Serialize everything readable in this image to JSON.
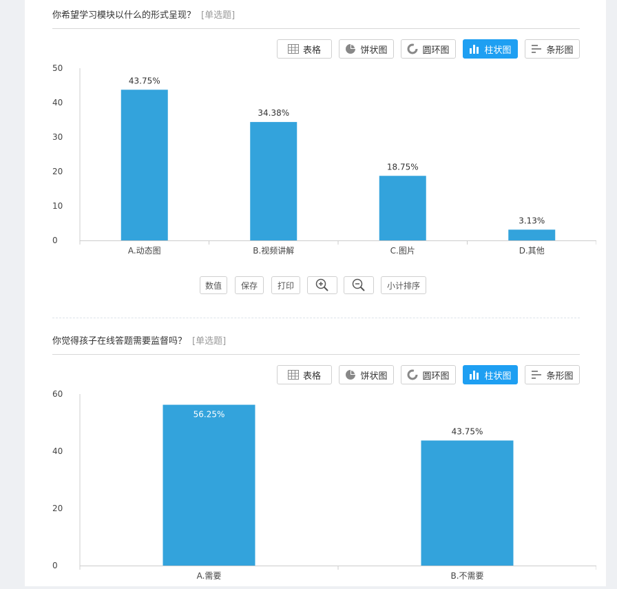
{
  "questions": [
    {
      "title": "你希望学习模块以什么的形式呈现？",
      "tag": "[单选题]",
      "toolbar": [
        "表格",
        "饼状图",
        "圆环图",
        "柱状图",
        "条形图"
      ],
      "active_view": "柱状图",
      "chart_data": {
        "type": "bar",
        "categories": [
          "A.动态图",
          "B.视频讲解",
          "C.图片",
          "D.其他"
        ],
        "values": [
          43.75,
          34.38,
          18.75,
          3.13
        ],
        "labels": [
          "43.75%",
          "34.38%",
          "18.75%",
          "3.13%"
        ],
        "yticks": [
          0,
          10,
          20,
          30,
          40,
          50
        ],
        "ylim": [
          0,
          50
        ],
        "bar_color": "#33a3dc"
      },
      "bottom_tools": [
        "数值",
        "保存",
        "打印",
        "zoom-in-icon",
        "zoom-out-icon",
        "小计排序"
      ]
    },
    {
      "title": "你觉得孩子在线答题需要监督吗？",
      "tag": "[单选题]",
      "toolbar": [
        "表格",
        "饼状图",
        "圆环图",
        "柱状图",
        "条形图"
      ],
      "active_view": "柱状图",
      "chart_data": {
        "type": "bar",
        "categories": [
          "A.需要",
          "B.不需要"
        ],
        "values": [
          56.25,
          43.75
        ],
        "labels": [
          "56.25%",
          "43.75%"
        ],
        "yticks": [
          0,
          20,
          40,
          60
        ],
        "ylim": [
          0,
          60
        ],
        "bar_color": "#33a3dc"
      }
    }
  ],
  "colors": {
    "accent": "#1e9ff2",
    "bar": "#33a3dc",
    "rule": "#d7d7d7"
  }
}
